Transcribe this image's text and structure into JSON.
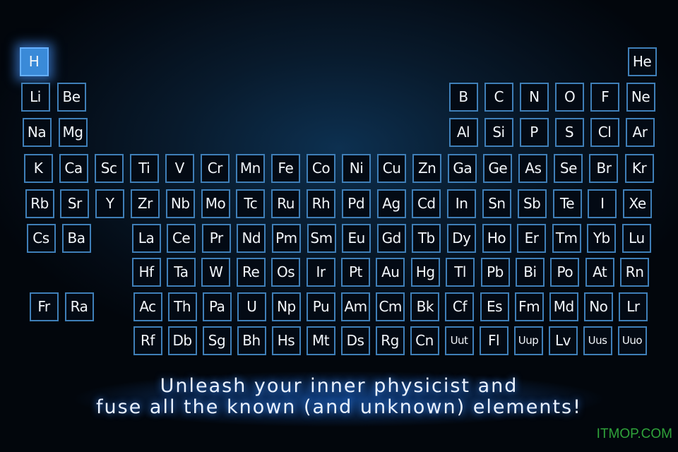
{
  "highlighted": "H",
  "accent_color": "#3a8ad8",
  "tile_border_color": "#3f7fb8",
  "rows": [
    [
      [
        "H"
      ],
      [
        "He"
      ]
    ],
    [
      [
        "Li",
        "Be"
      ],
      [
        "B",
        "C",
        "N",
        "O",
        "F",
        "Ne"
      ]
    ],
    [
      [
        "Na",
        "Mg"
      ],
      [
        "Al",
        "Si",
        "P",
        "S",
        "Cl",
        "Ar"
      ]
    ],
    [
      [
        "K",
        "Ca",
        "Sc",
        "Ti",
        "V",
        "Cr",
        "Mn",
        "Fe",
        "Co",
        "Ni",
        "Cu",
        "Zn",
        "Ga",
        "Ge",
        "As",
        "Se",
        "Br",
        "Kr"
      ]
    ],
    [
      [
        "Rb",
        "Sr",
        "Y",
        "Zr",
        "Nb",
        "Mo",
        "Tc",
        "Ru",
        "Rh",
        "Pd",
        "Ag",
        "Cd",
        "In",
        "Sn",
        "Sb",
        "Te",
        "I",
        "Xe"
      ]
    ],
    [
      [
        "Cs",
        "Ba"
      ],
      [
        "La",
        "Ce",
        "Pr",
        "Nd",
        "Pm",
        "Sm",
        "Eu",
        "Gd",
        "Tb",
        "Dy",
        "Ho",
        "Er",
        "Tm",
        "Yb",
        "Lu"
      ]
    ],
    [
      [
        "Hf",
        "Ta",
        "W",
        "Re",
        "Os",
        "Ir",
        "Pt",
        "Au",
        "Hg",
        "Tl",
        "Pb",
        "Bi",
        "Po",
        "At",
        "Rn"
      ]
    ],
    [
      [
        "Fr",
        "Ra"
      ],
      [
        "Ac",
        "Th",
        "Pa",
        "U",
        "Np",
        "Pu",
        "Am",
        "Cm",
        "Bk",
        "Cf",
        "Es",
        "Fm",
        "Md",
        "No",
        "Lr"
      ]
    ],
    [
      [
        "Rf",
        "Db",
        "Sg",
        "Bh",
        "Hs",
        "Mt",
        "Ds",
        "Rg",
        "Cn",
        "Uut",
        "Fl",
        "Uup",
        "Lv",
        "Uus",
        "Uuo"
      ]
    ]
  ],
  "caption": {
    "line1": "Unleash your inner physicist and",
    "line2": "fuse all the known (and unknown) elements!"
  },
  "watermark": "ITMOP.COM"
}
